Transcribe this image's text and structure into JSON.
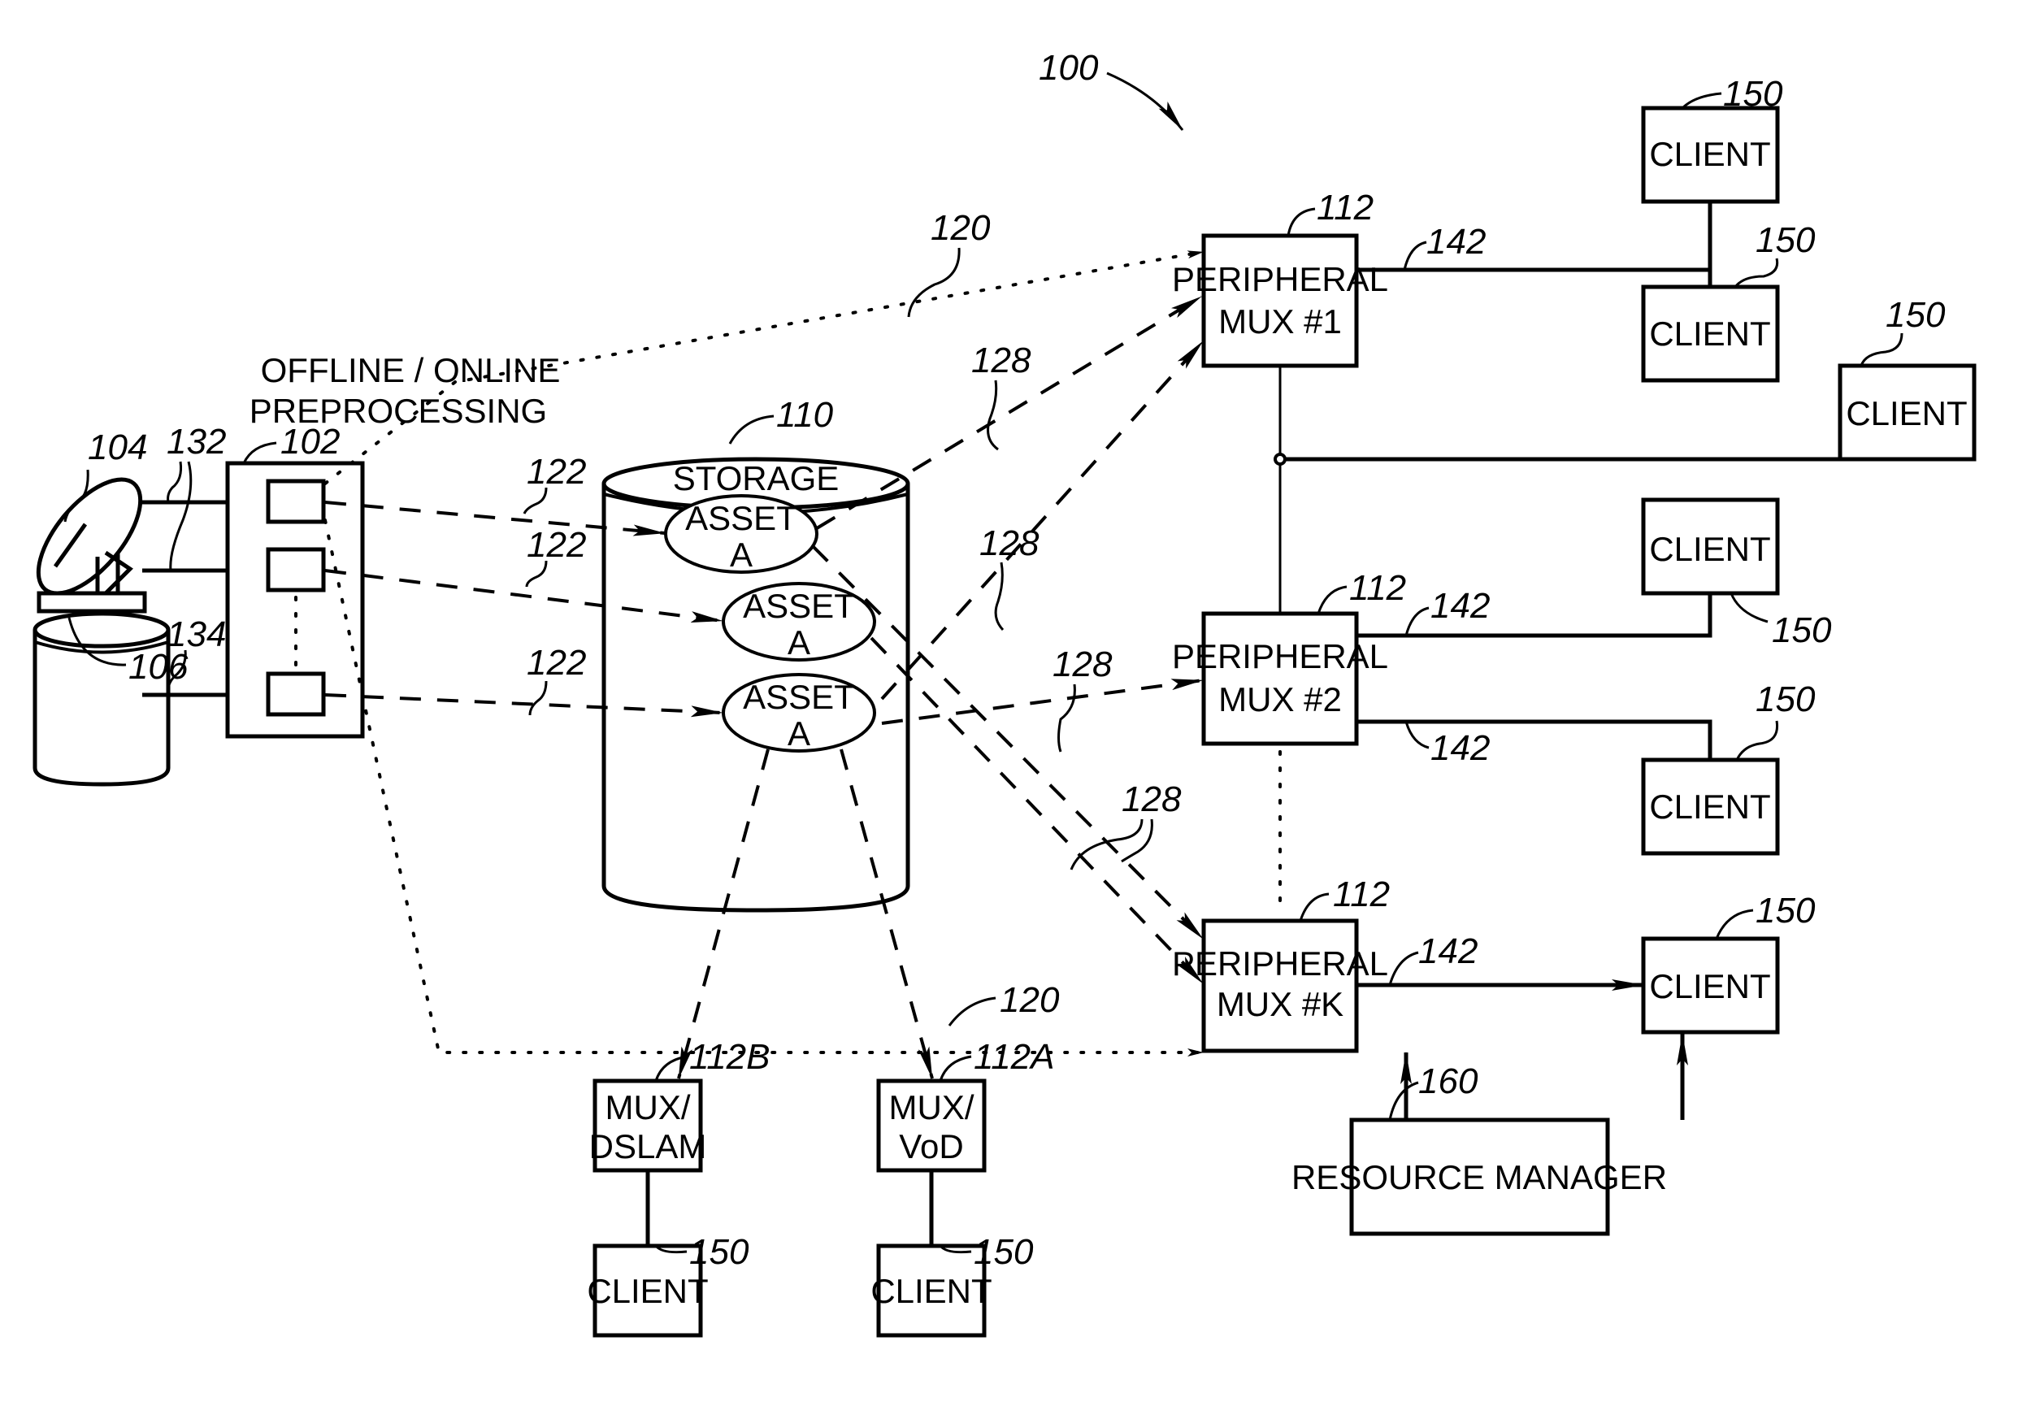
{
  "figure": {
    "system_ref": "100",
    "preprocessing_label_line1": "OFFLINE / ONLINE",
    "preprocessing_label_line2": "PREPROCESSING"
  },
  "sources": {
    "satellite_ref": "104",
    "disk_ref": "106",
    "input_ref_a": "132",
    "input_ref_b": "134",
    "preprocessor_ref": "102"
  },
  "storage": {
    "ref": "110",
    "label": "STORAGE",
    "assets": [
      {
        "line1": "ASSET",
        "line2": "A"
      },
      {
        "line1": "ASSET",
        "line2": "A"
      },
      {
        "line1": "ASSET",
        "line2": "A"
      }
    ],
    "ingest_refs": [
      "122",
      "122",
      "122"
    ]
  },
  "paths": {
    "bypass_ref": "120",
    "stream_ref": "128",
    "client_link_ref": "142"
  },
  "peripheral_muxes": [
    {
      "ref": "112",
      "line1": "PERIPHERAL",
      "line2": "MUX  #1"
    },
    {
      "ref": "112",
      "line1": "PERIPHERAL",
      "line2": "MUX  #2"
    },
    {
      "ref": "112",
      "line1": "PERIPHERAL",
      "line2": "MUX  #K"
    }
  ],
  "edge_muxes": [
    {
      "ref": "112B",
      "line1": "MUX/",
      "line2": "DSLAM"
    },
    {
      "ref": "112A",
      "line1": "MUX/",
      "line2": "VoD"
    }
  ],
  "client": {
    "ref": "150",
    "label": "CLIENT"
  },
  "resource_manager": {
    "ref": "160",
    "label": "RESOURCE  MANAGER"
  }
}
